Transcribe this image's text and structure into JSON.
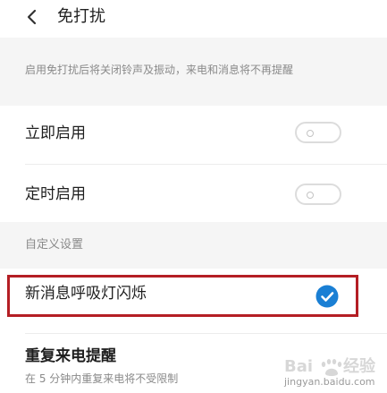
{
  "header": {
    "title": "免打扰",
    "back_icon": "chevron-left-icon"
  },
  "description": "启用免打扰后将关闭铃声及振动，来电和消息将不再提醒",
  "rows": {
    "immediate": {
      "label": "立即启用",
      "enabled": false
    },
    "scheduled": {
      "label": "定时启用",
      "enabled": false
    }
  },
  "custom_section": {
    "label": "自定义设置",
    "breathing_light": {
      "label": "新消息呼吸灯闪烁",
      "checked": true,
      "check_icon": "check-circle-icon"
    },
    "repeat_call": {
      "label": "重复来电提醒",
      "sublabel": "在 5 分钟内重复来电将不受限制"
    }
  },
  "watermark": {
    "text": "jingyan.baidu.com"
  },
  "colors": {
    "accent": "#1a7fd4",
    "highlight_border": "#b41e24",
    "toggle_border": "#dcdcdc",
    "band_background": "#f5f5f5",
    "secondary_text": "#8a8a8a"
  }
}
